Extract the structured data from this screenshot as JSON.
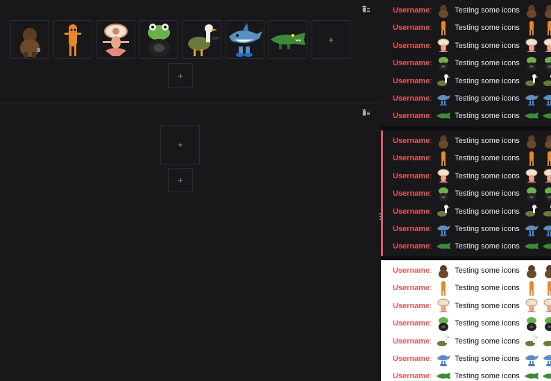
{
  "editor": {
    "section1": {
      "delete_icon": "trash-icon",
      "emotes": [
        {
          "name": "bigfoot",
          "color": "#6b4a2a"
        },
        {
          "name": "carrot-man",
          "color": "#e8872a"
        },
        {
          "name": "coffee-girl",
          "color": "#e7a68a"
        },
        {
          "name": "frog-tire",
          "color": "#5e9b3e"
        },
        {
          "name": "goose",
          "color": "#6b7a3a"
        },
        {
          "name": "shark",
          "color": "#5a8fc0"
        },
        {
          "name": "gator",
          "color": "#3e8a3a"
        }
      ],
      "add_slot_label": "+",
      "add_row_label": "+"
    },
    "section2": {
      "delete_icon": "trash-icon",
      "add_slot_label": "+",
      "add_row_label": "+"
    }
  },
  "chat": {
    "username": "Username",
    "colon": ":",
    "message": "Testing some icons",
    "panels": [
      "dark",
      "dark-highlight",
      "light"
    ]
  },
  "colors": {
    "username": "#e05a5a",
    "dark_bg": "#18181b",
    "light_bg": "#ffffff",
    "highlight": "#e05a5a"
  }
}
